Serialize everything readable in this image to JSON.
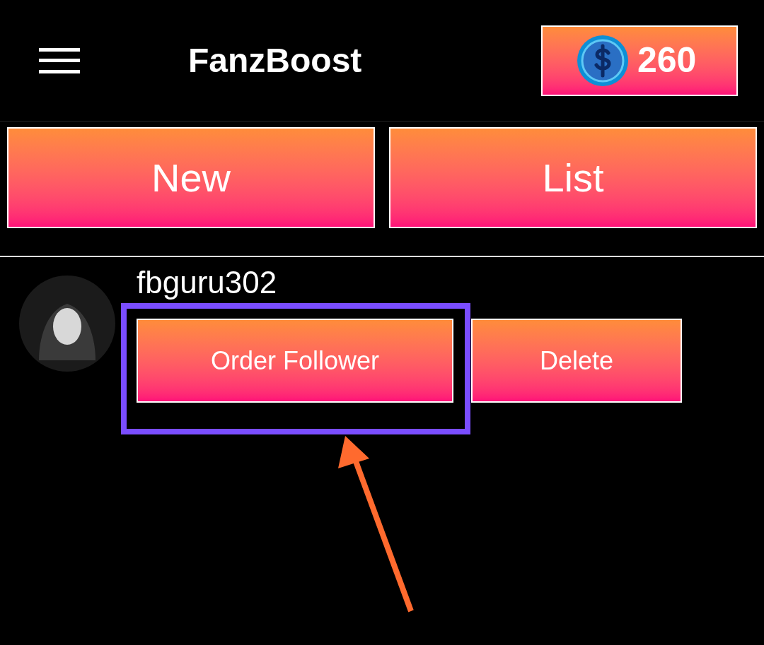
{
  "header": {
    "title": "FanzBoost",
    "coins": "260"
  },
  "nav_buttons": [
    "New",
    "List"
  ],
  "accounts": [
    {
      "username": "fbguru302",
      "actions": [
        "Order Follower",
        "Delete"
      ]
    }
  ]
}
